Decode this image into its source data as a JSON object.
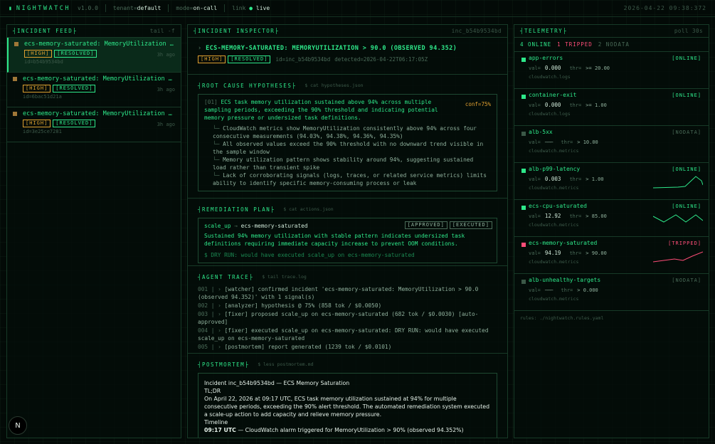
{
  "topbar": {
    "brand": "NIGHTWATCH",
    "version": "v1.0.0",
    "tenant_k": "tenant=",
    "tenant_v": "default",
    "mode_k": "mode=",
    "mode_v": "on-call",
    "link_k": "link ",
    "link_v": "live",
    "clock": "2026-04-22 09:38:372"
  },
  "feed": {
    "title": "INCIDENT FEED",
    "cmd": "tail -f",
    "items": [
      {
        "title": "ecs-memory-saturated: MemoryUtilization > 90.0 (observed 94.352)",
        "sev": "[HIGH]",
        "status": "[RESOLVED]",
        "ago": "3h ago",
        "id": "id=b54b9534bd"
      },
      {
        "title": "ecs-memory-saturated: MemoryUtilization > 90.0 (observed 94.352)",
        "sev": "[HIGH]",
        "status": "[RESOLVED]",
        "ago": "3h ago",
        "id": "id=6bac51d21a"
      },
      {
        "title": "ecs-memory-saturated: MemoryUtilization > 90.0 (observed 94.352)",
        "sev": "[HIGH]",
        "status": "[RESOLVED]",
        "ago": "3h ago",
        "id": "id=3e25ce7281"
      }
    ]
  },
  "inspector": {
    "title": "INCIDENT INSPECTOR",
    "ref": "inc_b54b9534bd",
    "headline": "ECS-MEMORY-SATURATED: MEMORYUTILIZATION > 90.0 (OBSERVED 94.352)",
    "sev": "[HIGH]",
    "status": "[RESOLVED]",
    "id": "id=inc_b54b9534bd",
    "detected": "detected=2026-04-22T06:17:05Z",
    "rca": {
      "title": "ROOT CAUSE HYPOTHESES",
      "cmd": "$ cat hypotheses.json",
      "idx": "[01]",
      "summary": "ECS task memory utilization sustained above 94% across multiple sampling periods, exceeding the 90% threshold and indicating potential memory pressure or undersized task definitions.",
      "conf": "conf=75%",
      "evidence": [
        "CloudWatch metrics show MemoryUtilization consistently above 94% across four consecutive measurements (94.03%, 94.38%, 94.36%, 94.35%)",
        "All observed values exceed the 90% threshold with no downward trend visible in the sample window",
        "Memory utilization pattern shows stability around 94%, suggesting sustained load rather than transient spike",
        "Lack of corroborating signals (logs, traces, or related service metrics) limits ability to identify specific memory-consuming process or leak"
      ]
    },
    "remediation": {
      "title": "REMEDIATION PLAN",
      "cmd": "$ cat actions.json",
      "action": "scale_up",
      "target": "ecs-memory-saturated",
      "approved": "[APPROVED]",
      "executed": "[EXECUTED]",
      "reason": "Sustained 94% memory utilization with stable pattern indicates undersized task definitions requiring immediate capacity increase to prevent OOM conditions.",
      "dry": "$ DRY RUN: would have executed scale_up on ecs-memory-saturated"
    },
    "trace": {
      "title": "AGENT TRACE",
      "cmd": "$ tail trace.log",
      "lines": [
        {
          "n": "001",
          "text": "[watcher] confirmed incident 'ecs-memory-saturated: MemoryUtilization > 90.0 (observed 94.352)' with 1 signal(s)"
        },
        {
          "n": "002",
          "text": "[analyzer] hypothesis @ 75% (858 tok / $0.0050)"
        },
        {
          "n": "003",
          "text": "[fixer] proposed scale_up on ecs-memory-saturated (682 tok / $0.0030) [auto-approved]"
        },
        {
          "n": "004",
          "text": "[fixer] executed scale_up on ecs-memory-saturated: DRY RUN: would have executed scale_up on ecs-memory-saturated"
        },
        {
          "n": "005",
          "text": "[postmortem] report generated (1239 tok / $0.0101)"
        }
      ]
    },
    "postmortem": {
      "title": "POSTMORTEM",
      "cmd": "$ less postmortem.md",
      "heading": "Incident inc_b54b9534bd — ECS Memory Saturation",
      "tldr": "TL;DR",
      "body": "On April 22, 2026 at 09:17 UTC, ECS task memory utilization sustained at 94% for multiple consecutive periods, exceeding the 90% alert threshold. The automated remediation system executed a scale-up action to add capacity and relieve memory pressure.",
      "timeline": "Timeline",
      "t1_time": "09:17 UTC",
      "t1_text": " — CloudWatch alarm triggered for MemoryUtilization > 90% (observed 94.352%)"
    }
  },
  "telemetry": {
    "title": "TELEMETRY",
    "cmd": "poll 30s",
    "online": "4 ONLINE",
    "tripped": "1 TRIPPED",
    "nodata": "2 NODATA",
    "rules": "rules: ./nightwatch.rules.yaml",
    "rows": [
      {
        "name": "app-errors",
        "status": "[ONLINE]",
        "val": "0.000",
        "thr": ">= 20.00",
        "src": "cloudwatch.logs",
        "state": "online"
      },
      {
        "name": "container-exit",
        "status": "[ONLINE]",
        "val": "0.000",
        "thr": ">= 1.00",
        "src": "cloudwatch.logs",
        "state": "online"
      },
      {
        "name": "alb-5xx",
        "status": "[NODATA]",
        "val": "———",
        "thr": "> 10.00",
        "src": "cloudwatch.metrics",
        "state": "nodata"
      },
      {
        "name": "alb-p99-latency",
        "status": "[ONLINE]",
        "val": "0.003",
        "thr": "> 1.00",
        "src": "cloudwatch.metrics",
        "state": "online"
      },
      {
        "name": "ecs-cpu-saturated",
        "status": "[ONLINE]",
        "val": "12.92",
        "thr": "> 85.00",
        "src": "cloudwatch.metrics",
        "state": "online"
      },
      {
        "name": "ecs-memory-saturated",
        "status": "[TRIPPED]",
        "val": "94.19",
        "thr": "> 90.00",
        "src": "cloudwatch.metrics",
        "state": "tripped"
      },
      {
        "name": "alb-unhealthy-targets",
        "status": "[NODATA]",
        "val": "———",
        "thr": "> 0.000",
        "src": "cloudwatch.metrics",
        "state": "nodata"
      }
    ],
    "labels": {
      "val": "val=",
      "thr": "thr="
    }
  },
  "colors": {
    "accent": "#2ee88a",
    "amber": "#e0a030",
    "tripped": "#ff4d78",
    "nodata": "#4a6b58"
  },
  "logo": "N"
}
